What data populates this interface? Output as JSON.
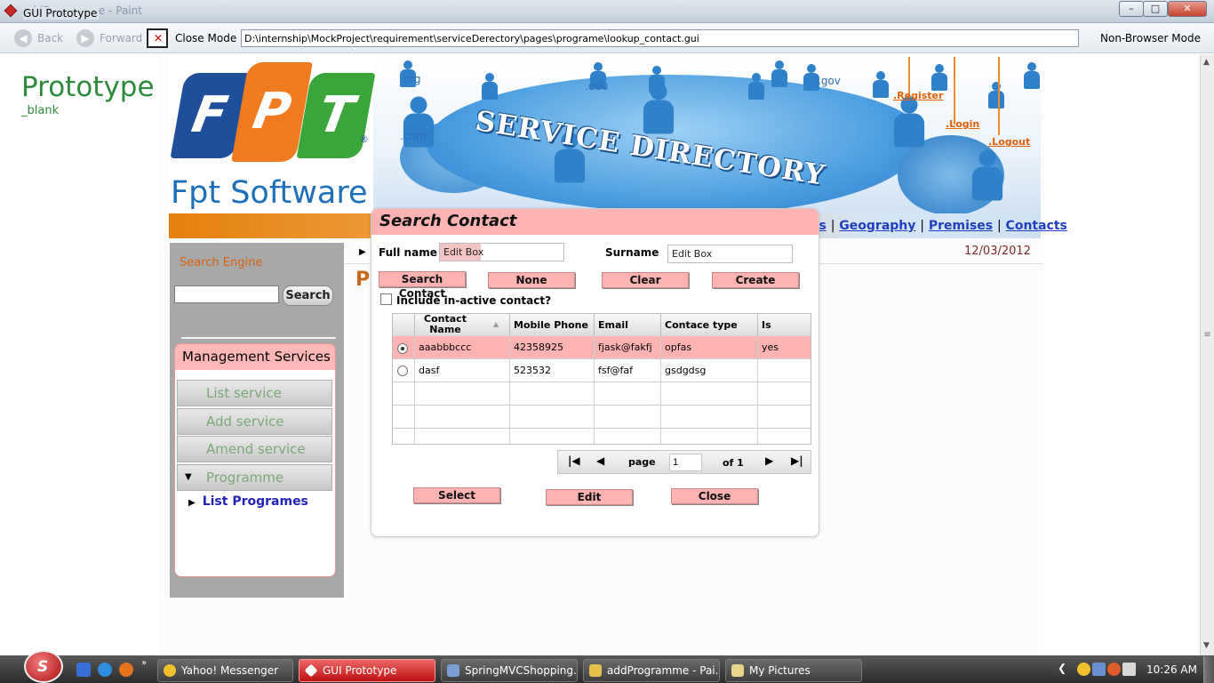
{
  "window": {
    "title_ghost": "addProgramme - Paint",
    "title": "GUI Prototype",
    "minimize_label": "–",
    "maximize_label": "□",
    "close_label": "✕"
  },
  "toolbar": {
    "back_label": "Back",
    "forward_label": "Forward",
    "close_mode_label": "Close Mode",
    "address": "D:\\internship\\MockProject\\requirement\\serviceDerectory\\pages\\programe\\lookup_contact.gui",
    "non_browser_label": "Non-Browser Mode"
  },
  "prototype": {
    "title": "Prototype",
    "subtitle": "_blank"
  },
  "banner": {
    "logo_letters": [
      "F",
      "P",
      "T"
    ],
    "logo_reg": "®",
    "company": "Fpt Software",
    "service_title": "SERVICE DIRECTORY",
    "tlds": [
      ".org",
      ".edu",
      ".gov",
      ".com"
    ],
    "links": {
      "register": ".Register",
      "login": ".Login",
      "logout": ".Logout"
    },
    "nav": {
      "partial": "es",
      "geography": "Geography",
      "premises": "Premises",
      "contacts": "Contacts",
      "sep": "|"
    }
  },
  "sidebar": {
    "search_engine_label": "Search Engine",
    "search_input_value": "",
    "search_button": "Search",
    "mgmt_header": "Management Services",
    "menu": [
      {
        "label": "List service"
      },
      {
        "label": "Add service"
      },
      {
        "label": "Amend service"
      },
      {
        "label": "Programme",
        "expanded": true
      }
    ],
    "submenu_item": "List Programes"
  },
  "content": {
    "date": "12/03/2012",
    "heading_initial": "P"
  },
  "dialog": {
    "title": "Search Contact",
    "fullname_label": "Full name",
    "fullname_value": "Edit Box",
    "surname_label": "Surname",
    "surname_value": "Edit Box",
    "buttons": {
      "search_contact": "Search Contact",
      "none": "None",
      "clear": "Clear",
      "create": "Create",
      "select": "Select",
      "edit": "Edit",
      "close": "Close"
    },
    "include_inactive_label": "Include in-active contact?",
    "include_inactive_checked": false,
    "columns": [
      "Contact Name",
      "Mobile Phone",
      "Email",
      "Contace type",
      "Is active?"
    ],
    "rows": [
      {
        "name": "aaabbbccc",
        "phone": "42358925",
        "email": "fjask@fakfj",
        "type": "opfas",
        "active": "yes",
        "selected": true
      },
      {
        "name": "dasf",
        "phone": "523532",
        "email": "fsf@faf",
        "type": "gsdgdsg",
        "active": "",
        "selected": false
      }
    ],
    "pager": {
      "page_label": "page",
      "page_value": "1",
      "of_label": "of 1"
    }
  },
  "taskbar": {
    "tasks": [
      {
        "label": "Yahoo! Messenger"
      },
      {
        "label": "GUI Prototype",
        "active": true
      },
      {
        "label": "SpringMVCShopping..."
      },
      {
        "label": "addProgramme - Pai..."
      },
      {
        "label": "My Pictures"
      }
    ],
    "clock": "10:26 AM"
  },
  "colors": {
    "accent_pink": "#ffb3b3",
    "prototype_green": "#2e8b3c",
    "nav_link_blue": "#1f3fbf",
    "orange": "#e0600a"
  }
}
